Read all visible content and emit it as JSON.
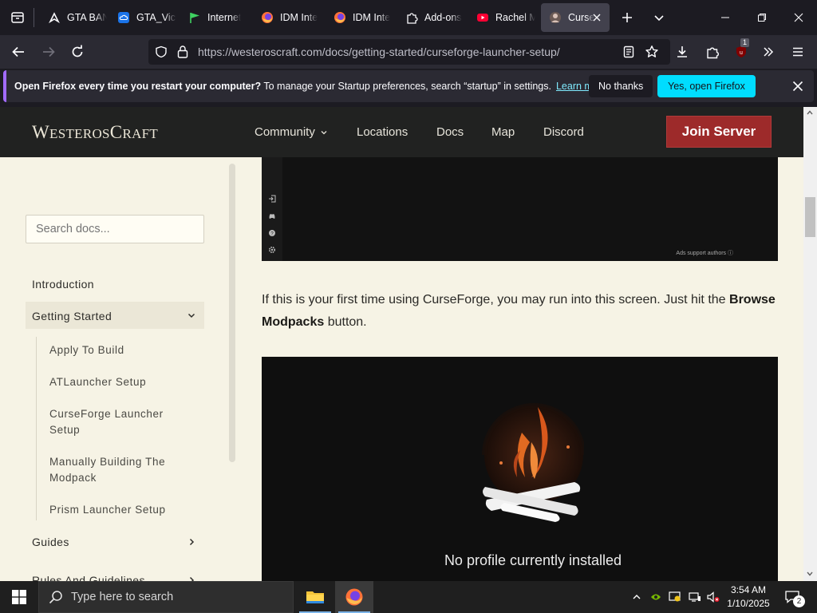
{
  "browser": {
    "tabs": [
      {
        "label": "GTA BAN",
        "icon": "rockstar-icon"
      },
      {
        "label": "GTA_Vice",
        "icon": "cloud-icon"
      },
      {
        "label": "Internet",
        "icon": "flag-icon"
      },
      {
        "label": "IDM Inte",
        "icon": "firefox-icon"
      },
      {
        "label": "IDM Inte",
        "icon": "firefox-icon"
      },
      {
        "label": "Add-ons",
        "icon": "puzzle-icon"
      },
      {
        "label": "Rachel M",
        "icon": "youtube-icon"
      },
      {
        "label": "Curse",
        "icon": "curseforge-icon",
        "active": true
      }
    ],
    "url_host": "https://westeroscraft.com",
    "url_path": "/docs/getting-started/curseforge-launcher-setup/",
    "extension_badge": "1"
  },
  "notification": {
    "bold": "Open Firefox every time you restart your computer?",
    "text": "To manage your Startup preferences, search “startup” in settings.",
    "link": "Learn more",
    "no_thanks": "No thanks",
    "yes": "Yes, open Firefox"
  },
  "site": {
    "logo_w": "W",
    "logo_esteros": "ESTEROS",
    "logo_c": "C",
    "logo_raft": "RAFT",
    "nav": {
      "community": "Community",
      "locations": "Locations",
      "docs": "Docs",
      "map": "Map",
      "discord": "Discord"
    },
    "join": "Join Server"
  },
  "sidebar": {
    "search_placeholder": "Search docs...",
    "introduction": "Introduction",
    "getting_started": "Getting Started",
    "sub": [
      "Apply To Build",
      "ATLauncher Setup",
      "CurseForge Launcher Setup",
      "Manually Building The Modpack",
      "Prism Launcher Setup"
    ],
    "guides": "Guides",
    "rules": "Rules And Guidelines"
  },
  "content": {
    "ads_note": "Ads support authors ⓘ",
    "para_pre": "If this is your first time using CurseForge, you may run into this screen. Just hit the ",
    "para_bold": "Browse Modpacks",
    "para_post": " button.",
    "no_profile": "No profile currently installed"
  },
  "taskbar": {
    "search": "Type here to search",
    "time": "3:54 AM",
    "date": "1/10/2025",
    "notif_count": "2"
  },
  "colors": {
    "accent": "#00ddff",
    "join": "#9d2a2a",
    "page_bg": "#f6f3e5",
    "header_bg": "#212221"
  }
}
